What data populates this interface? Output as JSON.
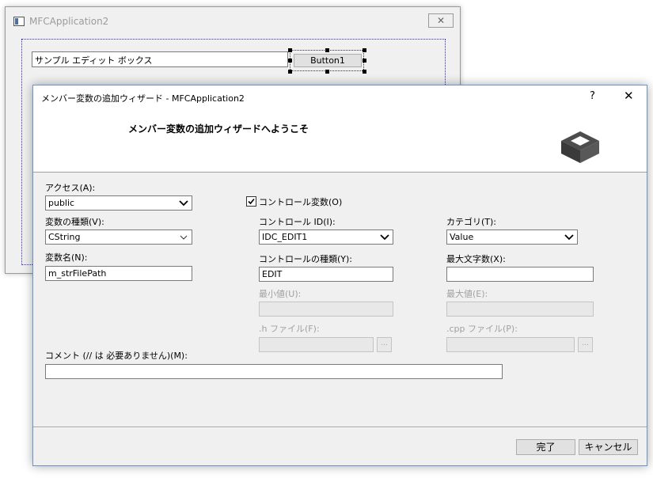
{
  "background_window": {
    "title": "MFCApplication2",
    "close_glyph": "✕",
    "edit_text": "サンプル エディット ボックス",
    "button_label": "Button1"
  },
  "dialog": {
    "title": "メンバー変数の追加ウィザード - MFCApplication2",
    "help_glyph": "?",
    "close_glyph": "✕",
    "welcome": "メンバー変数の追加ウィザードへようこそ",
    "access": {
      "label": "アクセス(A):",
      "value": "public"
    },
    "var_type": {
      "label": "変数の種類(V):",
      "value": "CString"
    },
    "var_name": {
      "label": "変数名(N):",
      "value": "m_strFilePath"
    },
    "control_var": {
      "label": "コントロール変数(O)",
      "checked": true
    },
    "control_id": {
      "label": "コントロール ID(I):",
      "value": "IDC_EDIT1"
    },
    "control_type": {
      "label": "コントロールの種類(Y):",
      "value": "EDIT"
    },
    "min_value": {
      "label": "最小値(U):",
      "value": ""
    },
    "h_file": {
      "label": ".h ファイル(F):",
      "value": "",
      "browse": "..."
    },
    "category": {
      "label": "カテゴリ(T):",
      "value": "Value"
    },
    "max_chars": {
      "label": "最大文字数(X):",
      "value": ""
    },
    "max_value": {
      "label": "最大値(E):",
      "value": ""
    },
    "cpp_file": {
      "label": ".cpp ファイル(P):",
      "value": "",
      "browse": "..."
    },
    "comment": {
      "label": "コメント (// は 必要ありません)(M):",
      "value": ""
    },
    "finish_button": "完了",
    "cancel_button": "キャンセル"
  }
}
